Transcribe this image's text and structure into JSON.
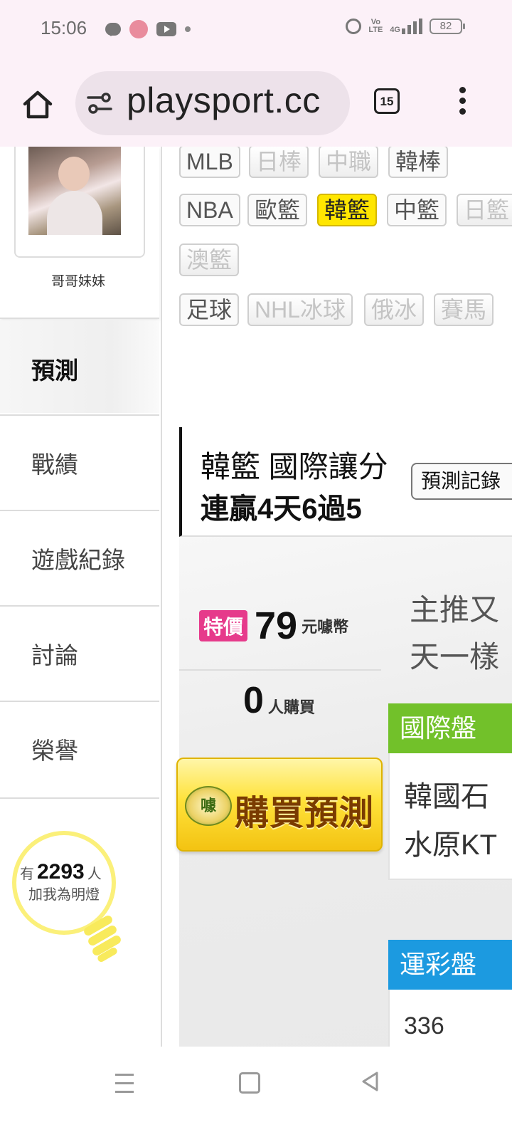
{
  "status_bar": {
    "time": "15:06",
    "volte": "Vo LTE",
    "network": "4G",
    "battery": "82"
  },
  "browser": {
    "url": "playsport.cc",
    "tab_count": "15",
    "icons": [
      "home-icon",
      "tune-icon",
      "tab-switcher-icon",
      "more-vert-icon"
    ]
  },
  "profile": {
    "name": "哥哥妹妹"
  },
  "sidebar": {
    "active": "預測",
    "items": [
      {
        "label": "戰績"
      },
      {
        "label": "遊戲紀錄"
      },
      {
        "label": "討論"
      },
      {
        "label": "榮譽"
      }
    ]
  },
  "follow": {
    "prefix": "有",
    "count": "2293",
    "suffix": "人",
    "line2": "加我為明燈"
  },
  "sport_tags": {
    "row1": [
      "MLB",
      "日棒",
      "中職",
      "韓棒"
    ],
    "row2": [
      "NBA",
      "歐籃",
      "韓籃",
      "中籃",
      "日籃"
    ],
    "row3": [
      "澳籃"
    ],
    "row4": [
      "足球",
      "NHL冰球",
      "俄冰",
      "賽馬"
    ],
    "active": "韓籃"
  },
  "prediction": {
    "title": "韓籃 國際讓分",
    "streak": "連贏4天6過5",
    "record_button": "預測記錄"
  },
  "purchase": {
    "badge": "特價",
    "price": "79",
    "unit": "元噱幣",
    "buyers": "0",
    "buyers_label": "人購買",
    "button_label": "購買預測",
    "coin_glyph": "噱",
    "intro_line1": "主推又",
    "intro_line2": "天一樣"
  },
  "odds": {
    "international": {
      "header": "國際盤",
      "line1": "韓國石",
      "line2": "水原KT"
    },
    "lottery": {
      "header": "運彩盤",
      "game_number": "336"
    }
  },
  "colors": {
    "active_tag": "#ffe600",
    "badge": "#e63a8b",
    "international_header": "#72c12a",
    "lottery_header": "#1c9ae0"
  }
}
